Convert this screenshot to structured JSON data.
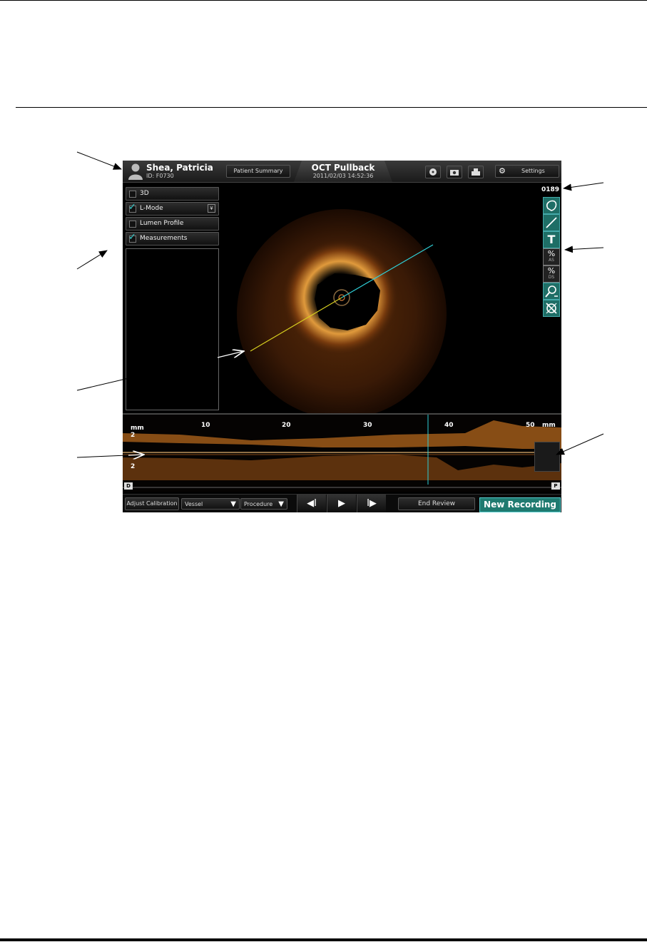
{
  "patient": {
    "name": "Shea, Patricia",
    "id": "ID: F0730"
  },
  "header": {
    "patient_summary": "Patient Summary",
    "title": "OCT Pullback",
    "datetime": "2011/02/03 14:52:36",
    "settings": "Settings"
  },
  "frame_number": "0189",
  "panel": {
    "options": [
      {
        "label": "3D",
        "checked": false
      },
      {
        "label": "L-Mode",
        "checked": true
      },
      {
        "label": "Lumen Profile",
        "checked": false
      },
      {
        "label": "Measurements",
        "checked": true
      }
    ]
  },
  "tools": [
    "area-icon",
    "length-icon",
    "text-annotation-icon",
    "percent-area-stenosis-icon",
    "percent-diameter-stenosis-icon",
    "zoom-icon",
    "delete-measurement-icon"
  ],
  "tool_labels": {
    "as_main": "%",
    "as_sub": "AS",
    "ds_main": "%",
    "ds_sub": "DS",
    "text": "T"
  },
  "lmode": {
    "axis_ticks": [
      "10",
      "20",
      "30",
      "40",
      "50"
    ],
    "unit": "mm",
    "left_unit": "mm",
    "left_scale_top": "2",
    "left_scale_bottom": "2",
    "distal_marker": "D",
    "proximal_marker": "P"
  },
  "bottom": {
    "adjust_calibration": "Adjust Calibration",
    "vessel": "Vessel",
    "procedure": "Procedure",
    "end_review": "End Review",
    "new_recording": "New Recording"
  },
  "colors": {
    "accent": "#1f7a70",
    "cyan": "#2fd0d8",
    "yellow": "#d8d020",
    "tissue": "#c87a1e"
  }
}
